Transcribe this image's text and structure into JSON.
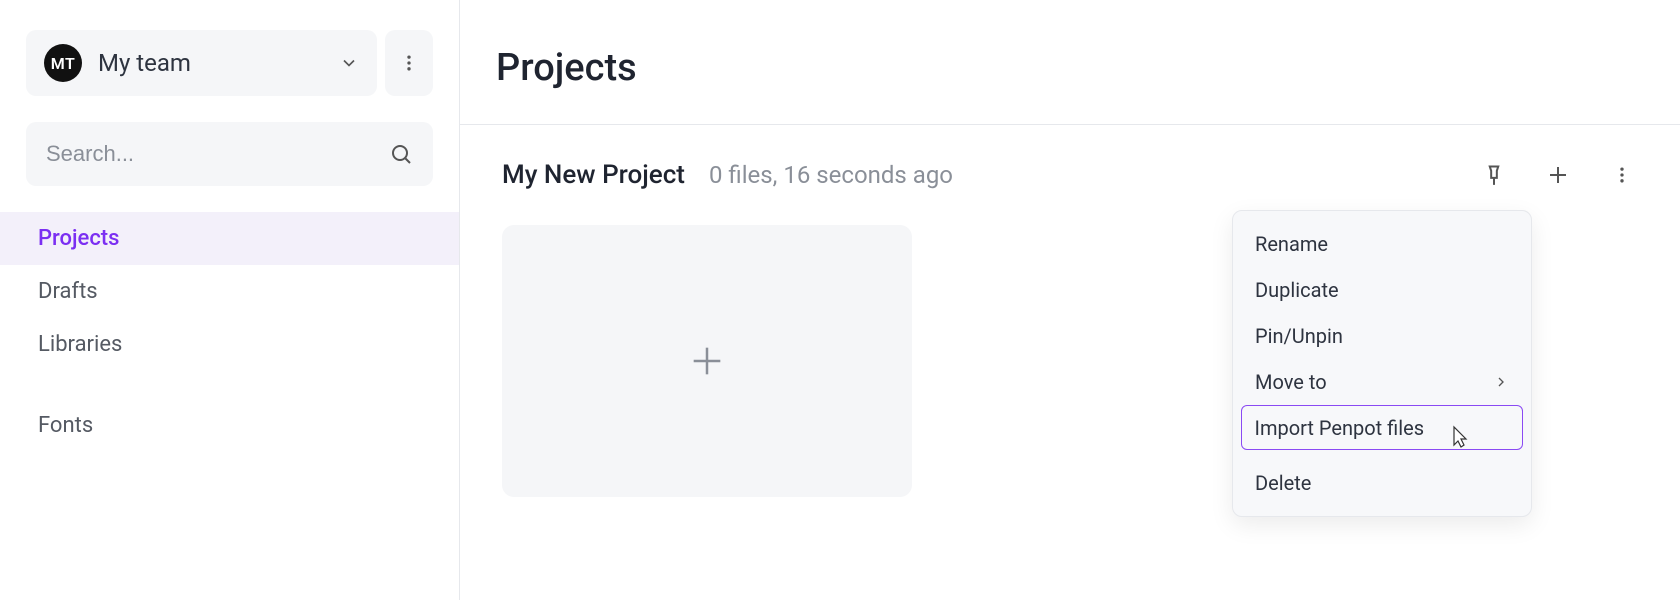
{
  "sidebar": {
    "team": {
      "avatar_initials": "MT",
      "name": "My team"
    },
    "search_placeholder": "Search...",
    "nav": [
      {
        "label": "Projects",
        "active": true
      },
      {
        "label": "Drafts",
        "active": false
      },
      {
        "label": "Libraries",
        "active": false
      }
    ],
    "nav_secondary": [
      {
        "label": "Fonts"
      }
    ]
  },
  "main": {
    "title": "Projects",
    "project": {
      "name": "My New Project",
      "meta": "0 files, 16 seconds ago"
    }
  },
  "context_menu": {
    "items": [
      {
        "label": "Rename",
        "highlighted": false,
        "submenu": false
      },
      {
        "label": "Duplicate",
        "highlighted": false,
        "submenu": false
      },
      {
        "label": "Pin/Unpin",
        "highlighted": false,
        "submenu": false
      },
      {
        "label": "Move to",
        "highlighted": false,
        "submenu": true
      },
      {
        "label": "Import Penpot files",
        "highlighted": true,
        "submenu": false
      }
    ],
    "delete_label": "Delete"
  }
}
